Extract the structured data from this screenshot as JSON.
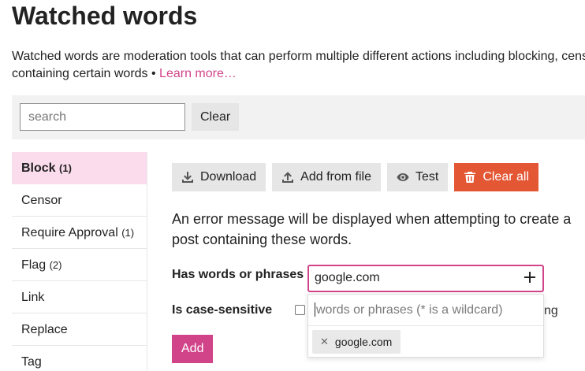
{
  "page": {
    "title": "Watched words",
    "description_line1": "Watched words are moderation tools that can perform multiple different actions including blocking, cens",
    "description_line2": "containing certain words •",
    "learn_more": "Learn more…"
  },
  "filter": {
    "search_placeholder": "search",
    "clear_label": "Clear"
  },
  "sidebar": {
    "items": [
      {
        "label": "Block",
        "count": "(1)"
      },
      {
        "label": "Censor",
        "count": ""
      },
      {
        "label": "Require Approval",
        "count": "(1)"
      },
      {
        "label": "Flag",
        "count": "(2)"
      },
      {
        "label": "Link",
        "count": ""
      },
      {
        "label": "Replace",
        "count": ""
      },
      {
        "label": "Tag",
        "count": ""
      }
    ]
  },
  "toolbar": {
    "download": "Download",
    "add_from_file": "Add from file",
    "test": "Test",
    "clear_all": "Clear all"
  },
  "main": {
    "info_text": "An error message will be displayed when attempting to create a post containing these words.",
    "words_label": "Has words or phrases",
    "case_label": "Is case-sensitive",
    "case_tail": "ng",
    "add_label": "Add"
  },
  "chooser": {
    "value": "google.com",
    "filter_placeholder": "words or phrases (* is a wildcard)",
    "selected_chip": "google.com"
  },
  "colors": {
    "accent": "#d1448a",
    "active_bg": "#fbdcec",
    "danger": "#e45735"
  }
}
